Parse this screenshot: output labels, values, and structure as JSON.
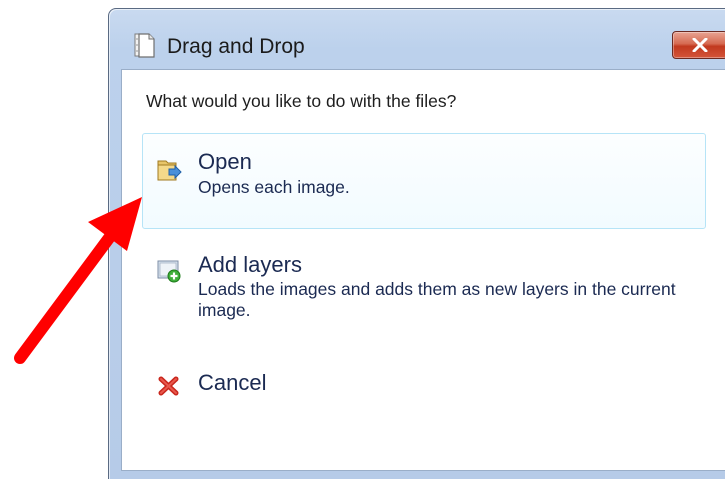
{
  "window": {
    "title": "Drag and Drop",
    "close_label": "Close"
  },
  "dialog": {
    "prompt": "What would you like to do with the files?",
    "options": [
      {
        "title": "Open",
        "description": "Opens each image.",
        "icon": "open-folder-icon"
      },
      {
        "title": "Add layers",
        "description": "Loads the images and adds them as new layers in the current image.",
        "icon": "add-layer-icon"
      },
      {
        "title": "Cancel",
        "description": "",
        "icon": "red-x-icon"
      }
    ]
  },
  "annotation": {
    "arrow_color": "#ff0000"
  }
}
